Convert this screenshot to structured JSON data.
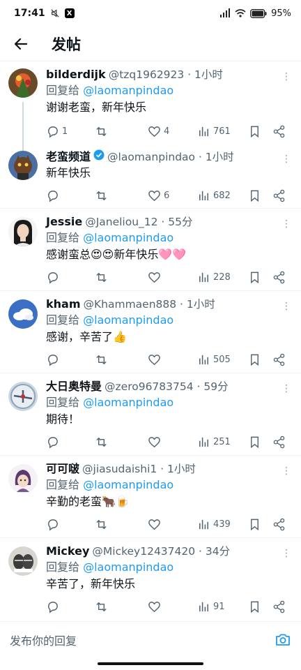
{
  "status_bar": {
    "time": "17:41",
    "battery": "95%"
  },
  "header": {
    "title": "发帖"
  },
  "reply_prefix": "回复给",
  "posts": [
    {
      "name": "bilderdijk",
      "handle": "@tzq1962923 · 1小时",
      "reply_to": "@laomanpindao",
      "text": "谢谢老蛮，新年快乐",
      "replies": "1",
      "likes": "4",
      "views": "761"
    },
    {
      "name": "老蛮频道",
      "handle": "@laomanpindao · 1小时",
      "text": "新年快乐",
      "replies": "",
      "likes": "6",
      "views": "682"
    },
    {
      "name": "Jessie",
      "handle": "@Janeliou_12 · 55分",
      "reply_to": "@laomanpindao",
      "text": "感谢蛮总😍😍新年快乐🩷🩷",
      "replies": "",
      "likes": "",
      "views": "228"
    },
    {
      "name": "kham",
      "handle": "@Khammaen888 · 1小时",
      "reply_to": "@laomanpindao",
      "text": "感谢，辛苦了👍",
      "replies": "",
      "likes": "",
      "views": "505"
    },
    {
      "name": "大日奥特曼",
      "handle": "@zero96783754 · 59分",
      "reply_to": "@laomanpindao",
      "text": "期待！",
      "replies": "",
      "likes": "",
      "views": "251"
    },
    {
      "name": "可可啵",
      "handle": "@jiasudaishi1 · 1小时",
      "reply_to": "@laomanpindao",
      "text": "辛勤的老蛮🐂🍺",
      "replies": "",
      "likes": "",
      "views": "439"
    },
    {
      "name": "Mickey",
      "handle": "@Mickey12437420 · 34分",
      "reply_to": "@laomanpindao",
      "text": "辛苦了，新年快乐",
      "replies": "",
      "likes": "",
      "views": "91"
    }
  ],
  "reply_bar": {
    "placeholder": "发布你的回复"
  },
  "colors": {
    "accent": "#1d9bf0",
    "secondary_text": "#536471",
    "divider": "#eff3f4"
  }
}
